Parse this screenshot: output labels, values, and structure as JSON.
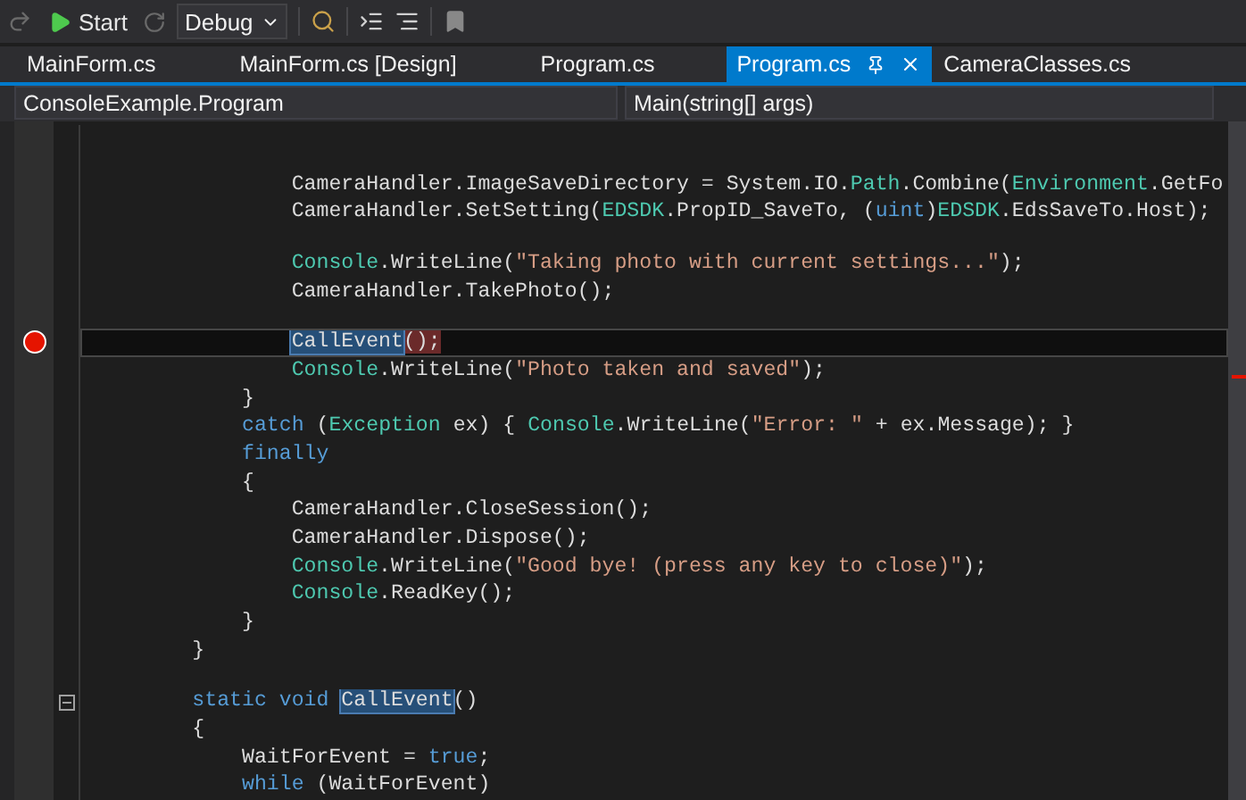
{
  "toolbar": {
    "start_label": "Start",
    "configuration": "Debug"
  },
  "tabs": [
    {
      "label": "MainForm.cs",
      "selected": false
    },
    {
      "label": "MainForm.cs [Design]",
      "selected": false
    },
    {
      "label": "Program.cs",
      "selected": false
    },
    {
      "label": "Program.cs",
      "selected": true
    },
    {
      "label": "CameraClasses.cs",
      "selected": false
    }
  ],
  "nav": {
    "type_name": "ConsoleExample.Program",
    "member_name": "Main(string[] args)"
  },
  "lines": [
    {
      "breakpoint": false,
      "current": false,
      "fold": false
    },
    {
      "breakpoint": false,
      "current": false,
      "fold": false
    },
    {
      "breakpoint": false,
      "current": false,
      "fold": false,
      "tokens": [
        {
          "kind": "plain",
          "text": "                CameraHandler.ImageSaveDirectory = System.IO."
        },
        {
          "kind": "type",
          "text": "Path"
        },
        {
          "kind": "plain",
          "text": ".Combine("
        },
        {
          "kind": "type",
          "text": "Environment"
        },
        {
          "kind": "plain",
          "text": ".GetFo"
        }
      ]
    },
    {
      "breakpoint": false,
      "current": false,
      "fold": false,
      "tokens": [
        {
          "kind": "plain",
          "text": "                CameraHandler.SetSetting("
        },
        {
          "kind": "type",
          "text": "EDSDK"
        },
        {
          "kind": "plain",
          "text": ".PropID_SaveTo, ("
        },
        {
          "kind": "keyword",
          "text": "uint"
        },
        {
          "kind": "plain",
          "text": ")"
        },
        {
          "kind": "type",
          "text": "EDSDK"
        },
        {
          "kind": "plain",
          "text": ".EdsSaveTo.Host);"
        }
      ]
    },
    {
      "breakpoint": false,
      "current": false,
      "fold": false
    },
    {
      "breakpoint": false,
      "current": false,
      "fold": false,
      "tokens": [
        {
          "kind": "type",
          "text": "                Console"
        },
        {
          "kind": "plain",
          "text": ".WriteLine("
        },
        {
          "kind": "string",
          "text": "\"Taking photo with current settings...\""
        },
        {
          "kind": "plain",
          "text": ");"
        }
      ]
    },
    {
      "breakpoint": false,
      "current": false,
      "fold": false,
      "tokens": [
        {
          "kind": "plain",
          "text": "                CameraHandler.TakePhoto();"
        }
      ]
    },
    {
      "breakpoint": false,
      "current": false,
      "fold": false
    },
    {
      "breakpoint": true,
      "current": true,
      "fold": false,
      "tokens": [
        {
          "kind": "match",
          "text": "                CallEvent"
        },
        {
          "kind": "brace",
          "text": "();"
        }
      ]
    },
    {
      "breakpoint": false,
      "current": false,
      "fold": false,
      "tokens": [
        {
          "kind": "type",
          "text": "                Console"
        },
        {
          "kind": "plain",
          "text": ".WriteLine("
        },
        {
          "kind": "string",
          "text": "\"Photo taken and saved\""
        },
        {
          "kind": "plain",
          "text": ");"
        }
      ]
    },
    {
      "breakpoint": false,
      "current": false,
      "fold": false,
      "tokens": [
        {
          "kind": "plain",
          "text": "            }"
        }
      ]
    },
    {
      "breakpoint": false,
      "current": false,
      "fold": false,
      "tokens": [
        {
          "kind": "keyword",
          "text": "            catch"
        },
        {
          "kind": "plain",
          "text": " ("
        },
        {
          "kind": "type",
          "text": "Exception"
        },
        {
          "kind": "plain",
          "text": " ex) { "
        },
        {
          "kind": "type",
          "text": "Console"
        },
        {
          "kind": "plain",
          "text": ".WriteLine("
        },
        {
          "kind": "string",
          "text": "\"Error: \""
        },
        {
          "kind": "plain",
          "text": " + ex.Message); }"
        }
      ]
    },
    {
      "breakpoint": false,
      "current": false,
      "fold": false,
      "tokens": [
        {
          "kind": "keyword",
          "text": "            finally"
        }
      ]
    },
    {
      "breakpoint": false,
      "current": false,
      "fold": false,
      "tokens": [
        {
          "kind": "plain",
          "text": "            {"
        }
      ]
    },
    {
      "breakpoint": false,
      "current": false,
      "fold": false,
      "tokens": [
        {
          "kind": "plain",
          "text": "                CameraHandler.CloseSession();"
        }
      ]
    },
    {
      "breakpoint": false,
      "current": false,
      "fold": false,
      "tokens": [
        {
          "kind": "plain",
          "text": "                CameraHandler.Dispose();"
        }
      ]
    },
    {
      "breakpoint": false,
      "current": false,
      "fold": false,
      "tokens": [
        {
          "kind": "type",
          "text": "                Console"
        },
        {
          "kind": "plain",
          "text": ".WriteLine("
        },
        {
          "kind": "string",
          "text": "\"Good bye! (press any key to close)\""
        },
        {
          "kind": "plain",
          "text": ");"
        }
      ]
    },
    {
      "breakpoint": false,
      "current": false,
      "fold": false,
      "tokens": [
        {
          "kind": "type",
          "text": "                Console"
        },
        {
          "kind": "plain",
          "text": ".ReadKey();"
        }
      ]
    },
    {
      "breakpoint": false,
      "current": false,
      "fold": false,
      "tokens": [
        {
          "kind": "plain",
          "text": "            }"
        }
      ]
    },
    {
      "breakpoint": false,
      "current": false,
      "fold": false,
      "tokens": [
        {
          "kind": "plain",
          "text": "        }"
        }
      ]
    },
    {
      "breakpoint": false,
      "current": false,
      "fold": false
    },
    {
      "breakpoint": false,
      "current": false,
      "fold": true,
      "tokens": [
        {
          "kind": "keyword",
          "text": "        static void "
        },
        {
          "kind": "match",
          "text": "CallEvent"
        },
        {
          "kind": "plain",
          "text": "()"
        }
      ]
    },
    {
      "breakpoint": false,
      "current": false,
      "fold": false,
      "tokens": [
        {
          "kind": "plain",
          "text": "        {"
        }
      ]
    },
    {
      "breakpoint": false,
      "current": false,
      "fold": false,
      "tokens": [
        {
          "kind": "plain",
          "text": "            WaitForEvent = "
        },
        {
          "kind": "keyword",
          "text": "true"
        },
        {
          "kind": "plain",
          "text": ";"
        }
      ]
    },
    {
      "breakpoint": false,
      "current": false,
      "fold": false,
      "tokens": [
        {
          "kind": "keyword",
          "text": "            while"
        },
        {
          "kind": "plain",
          "text": " (WaitForEvent)"
        }
      ]
    }
  ]
}
